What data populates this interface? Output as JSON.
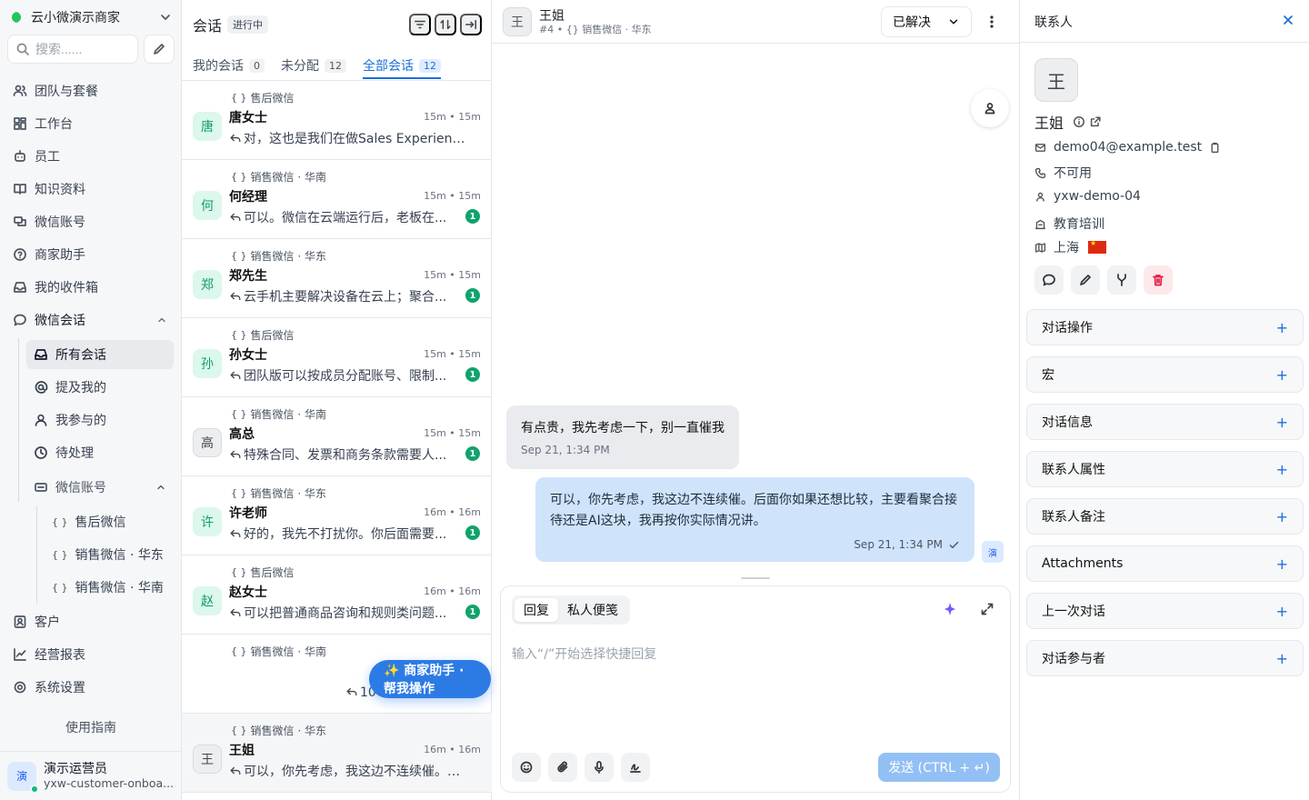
{
  "sidebar": {
    "org_name": "云小微演示商家",
    "search_placeholder": "搜索......",
    "nav": [
      {
        "label": "团队与套餐",
        "icon": "team-icon"
      },
      {
        "label": "工作台",
        "icon": "dashboard-icon"
      },
      {
        "label": "员工",
        "icon": "bot-icon"
      },
      {
        "label": "知识资料",
        "icon": "book-icon"
      },
      {
        "label": "微信账号",
        "icon": "account-icon"
      },
      {
        "label": "商家助手",
        "icon": "help-icon"
      },
      {
        "label": "我的收件箱",
        "icon": "inbox-icon"
      },
      {
        "label": "微信会话",
        "icon": "chat-icon"
      }
    ],
    "conversations_sub": [
      {
        "label": "所有会话",
        "icon": "inbox-icon"
      },
      {
        "label": "提及我的",
        "icon": "at-icon"
      },
      {
        "label": "我参与的",
        "icon": "user-icon"
      },
      {
        "label": "待处理",
        "icon": "clock-icon"
      },
      {
        "label": "微信账号",
        "icon": "account-icon"
      }
    ],
    "wechat_accounts": [
      "售后微信",
      "销售微信 · 华东",
      "销售微信 · 华南"
    ],
    "bottom_nav": [
      {
        "label": "客户",
        "icon": "contacts-icon"
      },
      {
        "label": "经营报表",
        "icon": "chart-icon"
      },
      {
        "label": "系统设置",
        "icon": "settings-icon"
      }
    ],
    "guide_label": "使用指南",
    "user": {
      "avatar": "演",
      "name": "演示运营员",
      "email": "yxw-customer-onboa..."
    }
  },
  "convlist": {
    "title": "会话",
    "status_badge": "进行中",
    "tabs": [
      {
        "label": "我的会话",
        "count": "0"
      },
      {
        "label": "未分配",
        "count": "12"
      },
      {
        "label": "全部会话",
        "count": "12"
      }
    ],
    "items": [
      {
        "inbox": "售后微信",
        "avatar": "唐",
        "name": "唐女士",
        "time": "15m • 15m",
        "message": "对，这也是我们在做Sales Experienc...",
        "unread": ""
      },
      {
        "inbox": "销售微信 · 华南",
        "avatar": "何",
        "name": "何经理",
        "time": "15m • 15m",
        "message": "可以。微信在云端运行后，老板在...",
        "unread": "1"
      },
      {
        "inbox": "销售微信 · 华东",
        "avatar": "郑",
        "name": "郑先生",
        "time": "15m • 15m",
        "message": "云手机主要解决设备在云上；聚合...",
        "unread": "1"
      },
      {
        "inbox": "售后微信",
        "avatar": "孙",
        "name": "孙女士",
        "time": "15m • 15m",
        "message": "团队版可以按成员分配账号、限制...",
        "unread": "1"
      },
      {
        "inbox": "销售微信 · 华南",
        "avatar": "高",
        "name": "高总",
        "time": "15m • 15m",
        "message": "特殊合同、发票和商务条款需要人...",
        "unread": "1"
      },
      {
        "inbox": "销售微信 · 华东",
        "avatar": "许",
        "name": "许老师",
        "time": "16m • 16m",
        "message": "好的，我先不打扰你。你后面需要...",
        "unread": "1"
      },
      {
        "inbox": "售后微信",
        "avatar": "赵",
        "name": "赵女士",
        "time": "16m • 16m",
        "message": "可以把普通商品咨询和规则类问题...",
        "unread": "1"
      },
      {
        "inbox": "销售微信 · 华南",
        "avatar": "",
        "name": "",
        "time": "16m • 16m",
        "message": "10个号不用在手...",
        "unread": "1"
      },
      {
        "inbox": "销售微信 · 华东",
        "avatar": "王",
        "name": "王姐",
        "time": "16m • 16m",
        "message": "可以，你先考虑，我这边不连续催。后...",
        "unread": ""
      }
    ],
    "fab_label": "✨ 商家助手 · 帮我操作"
  },
  "chat": {
    "avatar": "王",
    "name": "王姐",
    "subtitle": "#4 • {} 销售微信 · 华东",
    "status": "已解决",
    "messages": [
      {
        "direction": "in",
        "text": "有点贵，我先考虑一下，别一直催我",
        "time": "Sep 21, 1:34 PM"
      },
      {
        "direction": "out",
        "text": "可以，你先考虑，我这边不连续催。后面你如果还想比较，主要看聚合接待还是AI这块，我再按你实际情况讲。",
        "time": "Sep 21, 1:34 PM",
        "avatar": "演"
      }
    ],
    "editor": {
      "mode_reply": "回复",
      "mode_note": "私人便笺",
      "placeholder": "输入“/”开始选择快捷回复",
      "send_label": "发送 (CTRL + ↵)"
    }
  },
  "contact": {
    "header": "联系人",
    "avatar": "王",
    "name": "王姐",
    "email": "demo04@example.test",
    "phone": "不可用",
    "identifier": "yxw-demo-04",
    "company": "教育培训",
    "location": "上海"
  },
  "accordions": [
    "对话操作",
    "宏",
    "对话信息",
    "联系人属性",
    "联系人备注",
    "Attachments",
    "上一次对话",
    "对话参与者"
  ],
  "colors": {
    "accent": "#1d6fd8",
    "unread": "#10a36b",
    "outgoing_bubble": "#cfe3fb",
    "fab": "#2c7be5"
  }
}
